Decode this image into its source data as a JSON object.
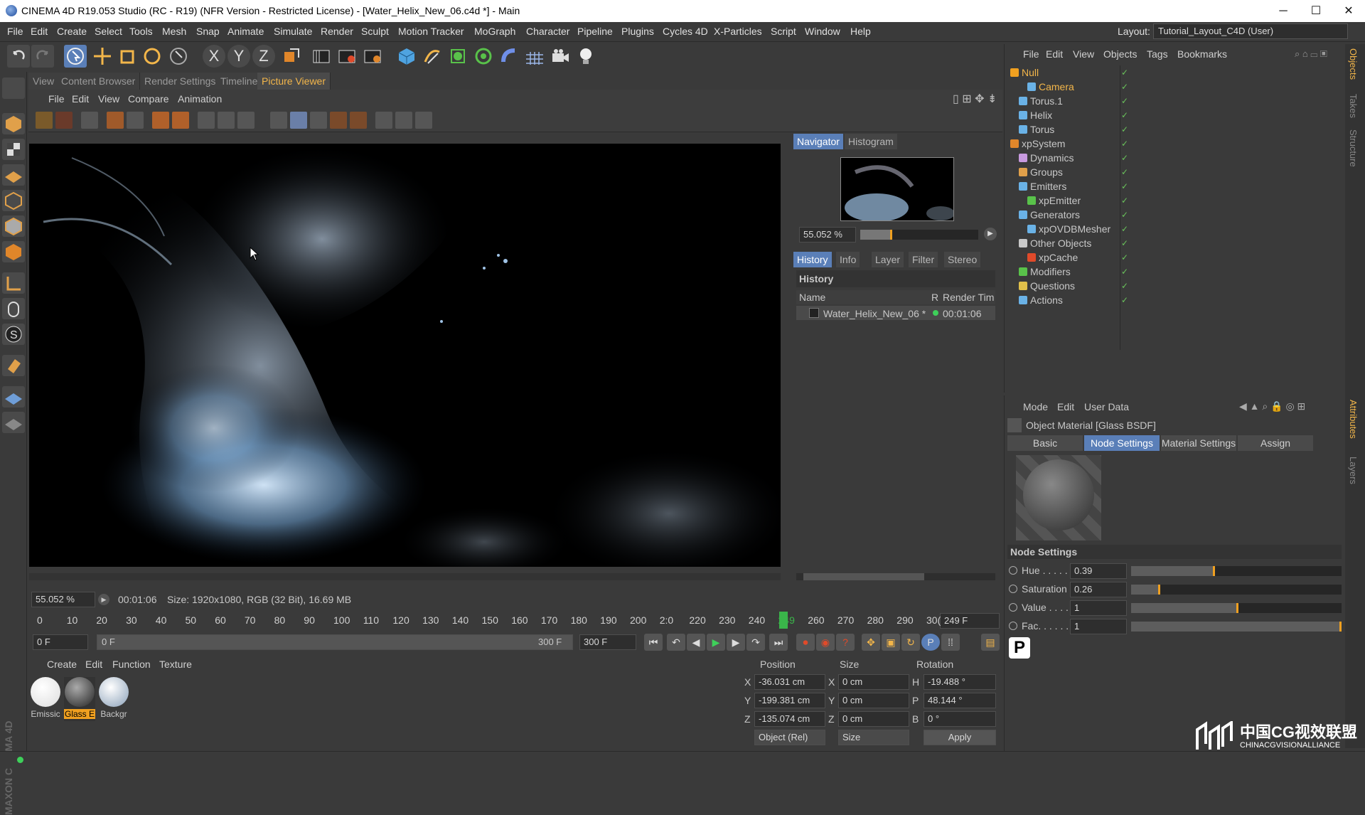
{
  "window": {
    "title": "CINEMA 4D R19.053 Studio (RC - R19) (NFR Version - Restricted License) - [Water_Helix_New_06.c4d *] - Main",
    "minimize": "─",
    "maximize": "☐",
    "close": "✕"
  },
  "menubar": {
    "items": [
      "File",
      "Edit",
      "Create",
      "Select",
      "Tools",
      "Mesh",
      "Snap",
      "Animate",
      "Simulate",
      "Render",
      "Sculpt",
      "Motion Tracker",
      "MoGraph",
      "Character",
      "Pipeline",
      "Plugins",
      "Cycles 4D",
      "X-Particles",
      "Script",
      "Window",
      "Help"
    ],
    "layout_label": "Layout:",
    "layout_value": "Tutorial_Layout_C4D (User)"
  },
  "toolbar": {
    "axis_x": "X",
    "axis_y": "Y",
    "axis_z": "Z"
  },
  "tabs": [
    "View",
    "Content Browser",
    "Render Settings",
    "Timeline",
    "Picture Viewer"
  ],
  "pv_menu": [
    "File",
    "Edit",
    "View",
    "Compare",
    "Animation"
  ],
  "navigator": {
    "tab_navigator": "Navigator",
    "tab_histogram": "Histogram",
    "zoom": "55.052 %",
    "zoom_fraction": 0.25
  },
  "history": {
    "tabs": [
      "History",
      "Info",
      "Layer",
      "Filter",
      "Stereo"
    ],
    "title": "History",
    "col_name": "Name",
    "col_r": "R",
    "col_time": "Render Tim",
    "row_name": "Water_Helix_New_06 *",
    "row_time": "00:01:06"
  },
  "status": {
    "zoom": "55.052 %",
    "time": "00:01:06",
    "info": "Size: 1920x1080, RGB (32 Bit), 16.69 MB"
  },
  "timeline": {
    "ticks": [
      "0",
      "10",
      "20",
      "30",
      "40",
      "50",
      "60",
      "70",
      "80",
      "90",
      "100",
      "110",
      "120",
      "130",
      "140",
      "150",
      "160",
      "170",
      "180",
      "190",
      "200",
      "2:0",
      "220",
      "230",
      "240",
      "249",
      "260",
      "270",
      "280",
      "290",
      "30("
    ],
    "current_frame": "249 F",
    "current_frame_label": "249"
  },
  "transport": {
    "start": "0 F",
    "range_start": "0 F",
    "range_end": "300 F",
    "end": "300 F"
  },
  "materials": {
    "menu": [
      "Create",
      "Edit",
      "Function",
      "Texture"
    ],
    "items": [
      {
        "name": "Emissic"
      },
      {
        "name": "Glass E"
      },
      {
        "name": "Backgr"
      }
    ]
  },
  "coords": {
    "col_position": "Position",
    "col_size": "Size",
    "col_rotation": "Rotation",
    "rows": [
      {
        "axis": "X",
        "pos": "-36.031 cm",
        "saxis": "X",
        "size": "0 cm",
        "raxis": "H",
        "rot": "-19.488 °"
      },
      {
        "axis": "Y",
        "pos": "-199.381 cm",
        "saxis": "Y",
        "size": "0 cm",
        "raxis": "P",
        "rot": "48.144 °"
      },
      {
        "axis": "Z",
        "pos": "-135.074 cm",
        "saxis": "Z",
        "size": "0 cm",
        "raxis": "B",
        "rot": "0 °"
      }
    ],
    "mode": "Object (Rel)",
    "size_mode": "Size",
    "apply": "Apply"
  },
  "objects": {
    "menu": [
      "File",
      "Edit",
      "View",
      "Objects",
      "Tags",
      "Bookmarks"
    ],
    "rows": [
      {
        "name": "Null",
        "color": "#f3b64a",
        "indent": 0
      },
      {
        "name": "Camera",
        "color": "#f3b64a",
        "indent": 2
      },
      {
        "name": "Torus.1",
        "color": "#c8c8c8",
        "indent": 1
      },
      {
        "name": "Helix",
        "color": "#c8c8c8",
        "indent": 1
      },
      {
        "name": "Torus",
        "color": "#c8c8c8",
        "indent": 1
      },
      {
        "name": "xpSystem",
        "color": "#c8c8c8",
        "indent": 0
      },
      {
        "name": "Dynamics",
        "color": "#c8c8c8",
        "indent": 1
      },
      {
        "name": "Groups",
        "color": "#c8c8c8",
        "indent": 1
      },
      {
        "name": "Emitters",
        "color": "#c8c8c8",
        "indent": 1
      },
      {
        "name": "xpEmitter",
        "color": "#c8c8c8",
        "indent": 2
      },
      {
        "name": "Generators",
        "color": "#c8c8c8",
        "indent": 1
      },
      {
        "name": "xpOVDBMesher",
        "color": "#c8c8c8",
        "indent": 2
      },
      {
        "name": "Other Objects",
        "color": "#c8c8c8",
        "indent": 1
      },
      {
        "name": "xpCache",
        "color": "#c8c8c8",
        "indent": 2
      },
      {
        "name": "Modifiers",
        "color": "#c8c8c8",
        "indent": 1
      },
      {
        "name": "Questions",
        "color": "#c8c8c8",
        "indent": 1
      },
      {
        "name": "Actions",
        "color": "#c8c8c8",
        "indent": 1
      }
    ]
  },
  "attributes": {
    "menu": [
      "Mode",
      "Edit",
      "User Data"
    ],
    "title": "Object Material [Glass BSDF]",
    "tabs": [
      "Basic",
      "Node Settings",
      "Material Settings",
      "Assign"
    ],
    "section": "Node Settings",
    "params": [
      {
        "label": "Hue . . . . . .",
        "value": "0.39",
        "fraction": 0.39
      },
      {
        "label": "Saturation",
        "value": "0.26",
        "fraction": 0.13
      },
      {
        "label": "Value . . . .",
        "value": "1",
        "fraction": 0.5
      },
      {
        "label": "Fac. . . . . . .",
        "value": "1",
        "fraction": 1.0
      }
    ]
  },
  "side_tabs": [
    "Objects",
    "Takes",
    "Structure",
    "Attributes",
    "Layers"
  ],
  "watermark": {
    "main": "中国CG视效联盟",
    "sub": "CHINACGVISIONALLIANCE"
  }
}
